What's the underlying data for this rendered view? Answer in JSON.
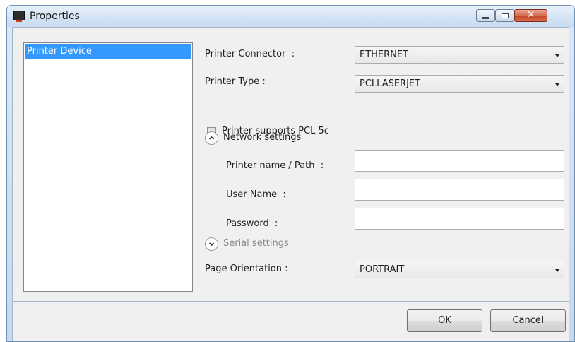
{
  "window": {
    "title": "Properties",
    "close_glyph": "✕"
  },
  "sidebar": {
    "items": [
      {
        "label": "Printer Device",
        "selected": true
      }
    ]
  },
  "form": {
    "printer_connector": {
      "label": "Printer Connector  :",
      "value": "ETHERNET"
    },
    "printer_type": {
      "label": "Printer Type :",
      "value": "PCLLASERJET"
    },
    "pcl5c": {
      "label": "Printer supports PCL 5c",
      "checked": false
    },
    "network_settings": {
      "label": "Network settings",
      "expanded": true
    },
    "printer_name": {
      "label": "Printer name / Path  :",
      "value": ""
    },
    "user_name": {
      "label": "User Name  :",
      "value": ""
    },
    "password": {
      "label": "Password  :",
      "value": ""
    },
    "serial_settings": {
      "label": "Serial settings",
      "expanded": false
    },
    "page_orientation": {
      "label": "Page Orientation :",
      "value": "PORTRAIT"
    }
  },
  "buttons": {
    "ok": "OK",
    "cancel": "Cancel"
  },
  "colors": {
    "selection": "#3399ff",
    "title_bar": "#d3e3f4",
    "close_button": "#c24427",
    "dialog_background": "#f0f0f0"
  },
  "icons": {
    "app": "printer-window-icon",
    "expand_up": "chevron-up-icon",
    "expand_down": "chevron-down-icon",
    "dropdown": "dropdown-arrow-icon"
  }
}
